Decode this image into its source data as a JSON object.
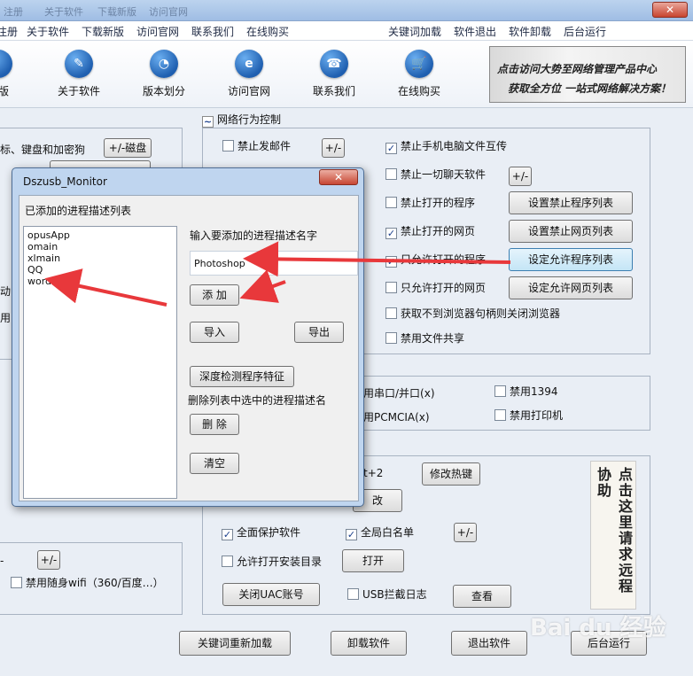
{
  "window": {
    "title_fragments": [
      "注册",
      "关于软件",
      "下载新版",
      "访问官网"
    ],
    "close_glyph": "✕"
  },
  "menubar": {
    "left": [
      "注册",
      "关于软件",
      "下载新版",
      "访问官网",
      "联系我们",
      "在线购买"
    ],
    "right": [
      "关键词加载",
      "软件退出",
      "软件卸载",
      "后台运行"
    ]
  },
  "toolbar": {
    "items": [
      {
        "label": "汇版",
        "icon": "info-icon",
        "glyph": "i"
      },
      {
        "label": "关于软件",
        "icon": "document-icon",
        "glyph": "✎"
      },
      {
        "label": "版本划分",
        "icon": "pie-chart-icon",
        "glyph": "◔"
      },
      {
        "label": "访问官网",
        "icon": "ie-browser-icon",
        "glyph": "e"
      },
      {
        "label": "联系我们",
        "icon": "phone-icon",
        "glyph": "☎"
      },
      {
        "label": "在线购买",
        "icon": "cart-icon",
        "glyph": "🛒"
      }
    ]
  },
  "banner": {
    "line1": "点击访问大势至网络管理产品中心",
    "line2": "获取全方位 一站式网络解决方案！"
  },
  "left_panel": {
    "text_top": "标、键盘和加密狗",
    "disk_button": "+/-磁盘",
    "frag1": "动",
    "frag2": "用",
    "plusminus": "+/-",
    "wifi_checkbox": "禁用随身wifi（360/百度…）",
    "wifi_checked": false
  },
  "network": {
    "title": "网络行为控制",
    "title_icon": "chart-icon",
    "checkboxes": [
      {
        "label": "禁止发邮件",
        "checked": false
      },
      {
        "label": "禁止手机电脑文件互传",
        "checked": true
      },
      {
        "label": "禁止一切聊天软件",
        "checked": false
      },
      {
        "label": "禁止打开的程序",
        "checked": false
      },
      {
        "label": "禁止打开的网页",
        "checked": true
      },
      {
        "label": "只允许打开的程序",
        "checked": true
      },
      {
        "label": "只允许打开的网页",
        "checked": false
      },
      {
        "label": "获取不到浏览器句柄则关闭浏览器",
        "checked": false
      },
      {
        "label": "禁用文件共享",
        "checked": false
      }
    ],
    "pm1": "+/-",
    "pm2": "+/-",
    "buttons": {
      "forbid_programs": "设置禁止程序列表",
      "forbid_pages": "设置禁止网页列表",
      "allow_programs": "设定允许程序列表",
      "allow_pages": "设定允许网页列表"
    }
  },
  "devices": {
    "serial": "用串口/并口(x)",
    "pcmcia": "用PCMCIA(x)",
    "ieee1394": {
      "label": "禁用1394",
      "checked": false
    },
    "printer": {
      "label": "禁用打印机",
      "checked": false
    }
  },
  "protection": {
    "hotkey_frag": "t+2",
    "hotkey_button": "修改热键",
    "modify_frag": "改",
    "full_protect": {
      "label": "全面保护软件",
      "checked": true
    },
    "global_whitelist": {
      "label": "全局白名单",
      "checked": true
    },
    "whitelist_pm": "+/-",
    "allow_install": {
      "label": "允许打开安装目录",
      "checked": false
    },
    "open_button": "打开",
    "uac_button": "关闭UAC账号",
    "usb_log": {
      "label": "USB拦截日志",
      "checked": false
    },
    "view_button": "查看",
    "ad_image": "点击这里请求远程协助"
  },
  "footer": {
    "reload": "关键词重新加载",
    "uninstall": "卸载软件",
    "exit": "退出软件",
    "background": "后台运行"
  },
  "dialog": {
    "title": "Dszusb_Monitor",
    "close_glyph": "✕",
    "list_title": "已添加的进程描述列表",
    "processes": [
      "opusApp",
      "omain",
      "xlmain",
      "QQ",
      "word"
    ],
    "input_label": "输入要添加的进程描述名字",
    "input_value": "Photoshop",
    "add_button": "添 加",
    "import_button": "导入",
    "export_button": "导出",
    "deep_detect_button": "深度检测程序特征",
    "delete_label": "删除列表中选中的进程描述名",
    "delete_button": "删 除",
    "clear_button": "清空"
  },
  "annotation": {
    "arrow_color": "#e8383b"
  },
  "watermark": "Bai du 经验"
}
